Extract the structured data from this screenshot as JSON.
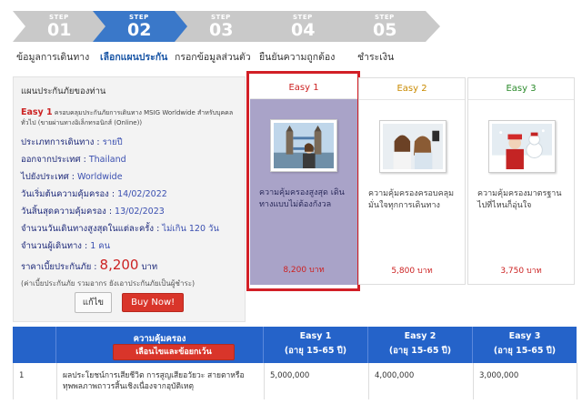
{
  "steps": [
    {
      "word": "STEP",
      "num": "01",
      "label": "ข้อมูลการเดินทาง",
      "active": false
    },
    {
      "word": "STEP",
      "num": "02",
      "label": "เลือกแผนประกัน",
      "active": true
    },
    {
      "word": "STEP",
      "num": "03",
      "label": "กรอกข้อมูลส่วนตัว",
      "active": false
    },
    {
      "word": "STEP",
      "num": "04",
      "label": "ยืนยันความถูกต้อง",
      "active": false
    },
    {
      "word": "STEP",
      "num": "05",
      "label": "ชำระเงิน",
      "active": false
    }
  ],
  "summary": {
    "title": "แผนประกันภัยของท่าน",
    "plan_name": "Easy 1",
    "plan_desc": "ครอบคลุมประกันภัยการเดินทาง MSIG Worldwide สำหรับบุคคลทั่วไป (ขายผ่านทางอิเล็กทรอนิกส์ (Online))",
    "rows": [
      {
        "label": "ประเภทการเดินทาง : ",
        "value": "รายปี"
      },
      {
        "label": "ออกจากประเทศ : ",
        "value": "Thailand"
      },
      {
        "label": "ไปยังประเทศ : ",
        "value": "Worldwide"
      },
      {
        "label": "วันเริ่มต้นความคุ้มครอง : ",
        "value": "14/02/2022"
      },
      {
        "label": "วันสิ้นสุดความคุ้มครอง : ",
        "value": "13/02/2023"
      },
      {
        "label": "จำนวนวันเดินทางสูงสุดในแต่ละครั้ง : ",
        "value": "ไม่เกิน 120   วัน"
      },
      {
        "label": "จำนวนผู้เดินทาง : ",
        "value": "1 คน"
      }
    ],
    "price_label": "ราคาเบี้ยประกันภัย : ",
    "price_amount": "8,200",
    "price_unit": " บาท",
    "note": "(ค่าเบี้ยประกันภัย รวมอากร ยังเอาประกันภัยเป็นผู้ชำระ)",
    "edit_label": "แก้ไข",
    "buy_label": "Buy Now!"
  },
  "cards": [
    {
      "name": "Easy 1",
      "name_color": "#cc2222",
      "desc": "ความคุ้มครองสูงสุด เดินทางแบบไม่ต้องกังวล",
      "price": "8,200 บาท",
      "photo": "tower-bridge-photo"
    },
    {
      "name": "Easy 2",
      "name_color": "#c98a00",
      "desc": "ความคุ้มครองครอบคลุม มั่นใจทุกการเดินทาง",
      "price": "5,800 บาท",
      "photo": "selfie-photo"
    },
    {
      "name": "Easy 3",
      "name_color": "#2a8a2a",
      "desc": "ความคุ้มครองมาตรฐาน ไปที่ไหนก็อุ่นใจ",
      "price": "3,750 บาท",
      "photo": "snow-photo"
    }
  ],
  "table": {
    "coverage_header": "ความคุ้มครอง",
    "select_button": "เลือนไขและข้อยกเว้น",
    "plans": [
      {
        "name": "Easy 1",
        "age": "(อายุ 15-65 ปี)"
      },
      {
        "name": "Easy 2",
        "age": "(อายุ 15-65 ปี)"
      },
      {
        "name": "Easy 3",
        "age": "(อายุ 15-65 ปี)"
      }
    ],
    "rows": [
      {
        "no": "1",
        "desc": "ผลประโยชน์การเสียชีวิต การสูญเสียอวัยวะ สายตาหรือทุพพลภาพถาวรสิ้นเชิงเนื่องจากอุบัติเหตุ",
        "values": [
          "5,000,000",
          "4,000,000",
          "3,000,000"
        ]
      }
    ]
  },
  "colors": {
    "accent_blue": "#2563c9",
    "active_step": "#1a56a6",
    "buy_red": "#d9352a",
    "selected_card": "#a9a3c8"
  }
}
